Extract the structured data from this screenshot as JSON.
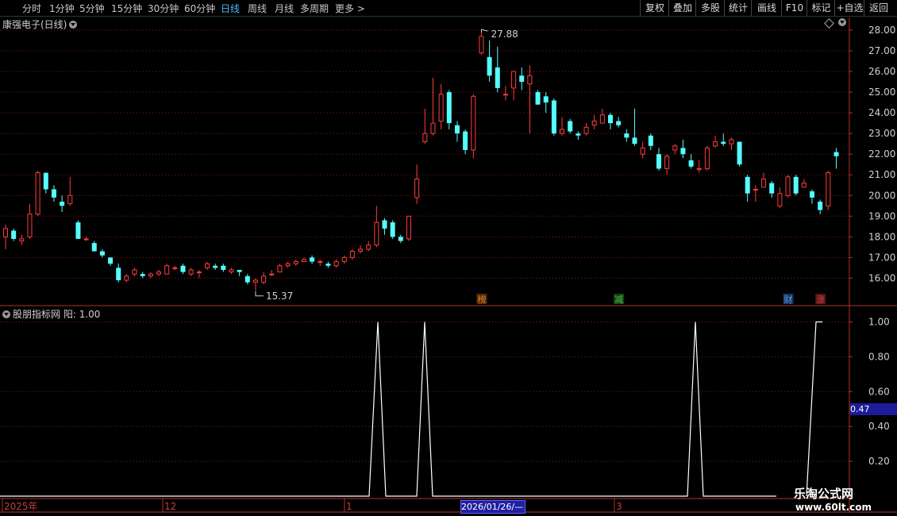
{
  "toolbar": {
    "periods": [
      "分时",
      "1分钟",
      "5分钟",
      "15分钟",
      "30分钟",
      "60分钟",
      "日线",
      "周线",
      "月线",
      "多周期",
      "更多 >"
    ],
    "active_period": "日线",
    "buttons": [
      "复权",
      "叠加",
      "多股",
      "统计",
      "画线",
      "F10",
      "标记",
      "+自选",
      "返回"
    ]
  },
  "price_panel": {
    "title": "康强电子(日线)",
    "y_ticks": [
      "28.00",
      "27.00",
      "26.00",
      "25.00",
      "24.00",
      "23.00",
      "22.00",
      "21.00",
      "20.00",
      "19.00",
      "18.00",
      "17.00",
      "16.00"
    ],
    "high_annotation": "27.88",
    "low_annotation": "15.37",
    "badges": [
      {
        "text": "榜",
        "color": "#e08020"
      },
      {
        "text": "减",
        "color": "#40c040"
      },
      {
        "text": "财",
        "color": "#4a9aff"
      },
      {
        "text": "涨",
        "color": "#e04040"
      }
    ]
  },
  "indicator_panel": {
    "title": "股朋指标网",
    "value_label": "阳: 1.00",
    "y_ticks": [
      "1.00",
      "0.80",
      "0.60",
      "0.40",
      "0.20"
    ],
    "current_value": "0.47"
  },
  "x_axis": {
    "labels": [
      "2025年",
      "12",
      "1",
      "3"
    ],
    "selected_date": "2026/01/26/—"
  },
  "watermark": {
    "line1": "乐淘公式网",
    "line2": "www.60lt.com"
  },
  "colors": {
    "up": "#ff3c3c",
    "down": "#54ffff",
    "grid": "#8b1a1a",
    "axis": "#b03030",
    "line": "#ffffff"
  },
  "chart_data": [
    {
      "type": "candlestick",
      "title": "康强电子(日线)",
      "ylim": [
        15.2,
        28.4
      ],
      "candles": [
        [
          18.0,
          18.4,
          18.6,
          17.4
        ],
        [
          18.3,
          17.9,
          18.4,
          17.8
        ],
        [
          17.8,
          17.9,
          18.1,
          17.6
        ],
        [
          18.0,
          19.1,
          19.6,
          17.9
        ],
        [
          19.1,
          21.1,
          21.2,
          19.0
        ],
        [
          21.1,
          20.3,
          21.1,
          20.1
        ],
        [
          20.3,
          19.9,
          20.5,
          19.7
        ],
        [
          19.7,
          19.5,
          20.0,
          19.2
        ],
        [
          19.6,
          20.0,
          20.9,
          19.5
        ],
        [
          18.7,
          17.9,
          18.8,
          17.9
        ],
        [
          17.9,
          17.9,
          18.0,
          17.8
        ],
        [
          17.7,
          17.3,
          17.8,
          17.3
        ],
        [
          17.3,
          17.1,
          17.4,
          17.0
        ],
        [
          17.0,
          16.7,
          17.0,
          16.6
        ],
        [
          16.5,
          15.9,
          16.7,
          15.8
        ],
        [
          15.9,
          16.1,
          16.2,
          15.8
        ],
        [
          16.2,
          16.4,
          16.5,
          16.1
        ],
        [
          16.2,
          16.1,
          16.3,
          16.0
        ],
        [
          16.1,
          16.2,
          16.3,
          16.0
        ],
        [
          16.2,
          16.3,
          16.4,
          16.1
        ],
        [
          16.2,
          16.6,
          16.7,
          16.2
        ],
        [
          16.5,
          16.5,
          16.6,
          16.4
        ],
        [
          16.6,
          16.3,
          16.7,
          16.2
        ],
        [
          16.2,
          16.4,
          16.5,
          16.1
        ],
        [
          16.3,
          16.3,
          16.4,
          16.0
        ],
        [
          16.5,
          16.7,
          16.8,
          16.4
        ],
        [
          16.6,
          16.5,
          16.7,
          16.4
        ],
        [
          16.6,
          16.4,
          16.7,
          16.3
        ],
        [
          16.3,
          16.4,
          16.5,
          16.2
        ],
        [
          16.4,
          16.3,
          16.4,
          16.1
        ],
        [
          16.1,
          15.8,
          16.2,
          15.7
        ],
        [
          15.8,
          15.9,
          16.0,
          15.4
        ],
        [
          15.8,
          16.1,
          16.3,
          15.7
        ],
        [
          16.2,
          16.2,
          16.4,
          16.1
        ],
        [
          16.3,
          16.6,
          16.7,
          16.3
        ],
        [
          16.6,
          16.7,
          16.8,
          16.5
        ],
        [
          16.7,
          16.8,
          16.9,
          16.6
        ],
        [
          16.8,
          16.9,
          17.0,
          16.8
        ],
        [
          17.0,
          16.8,
          17.1,
          16.7
        ],
        [
          16.8,
          16.8,
          16.9,
          16.6
        ],
        [
          16.7,
          16.6,
          16.8,
          16.5
        ],
        [
          16.6,
          16.8,
          16.9,
          16.5
        ],
        [
          16.8,
          17.0,
          17.1,
          16.7
        ],
        [
          17.0,
          17.3,
          17.4,
          16.9
        ],
        [
          17.3,
          17.4,
          17.6,
          17.2
        ],
        [
          17.4,
          17.6,
          17.8,
          17.3
        ],
        [
          17.6,
          18.7,
          19.5,
          17.5
        ],
        [
          18.8,
          18.4,
          18.9,
          18.1
        ],
        [
          18.7,
          18.0,
          18.8,
          17.9
        ],
        [
          18.0,
          17.8,
          18.1,
          17.7
        ],
        [
          17.9,
          19.0,
          19.0,
          17.8
        ],
        [
          19.9,
          20.8,
          21.5,
          19.6
        ],
        [
          22.6,
          23.0,
          24.2,
          22.5
        ],
        [
          23.0,
          23.5,
          25.7,
          22.9
        ],
        [
          23.6,
          24.9,
          25.4,
          23.2
        ],
        [
          25.0,
          23.5,
          25.1,
          23.2
        ],
        [
          23.4,
          23.0,
          23.6,
          22.6
        ],
        [
          23.1,
          22.2,
          23.2,
          22.0
        ],
        [
          22.2,
          24.8,
          24.9,
          21.8
        ],
        [
          26.9,
          27.7,
          27.9,
          26.8
        ],
        [
          26.7,
          25.8,
          27.5,
          25.5
        ],
        [
          26.2,
          25.2,
          27.2,
          25.0
        ],
        [
          24.9,
          24.9,
          25.3,
          24.6
        ],
        [
          25.2,
          26.0,
          26.0,
          24.6
        ],
        [
          25.8,
          25.5,
          26.2,
          25.1
        ],
        [
          25.4,
          25.8,
          26.3,
          23.0
        ],
        [
          25.0,
          24.4,
          25.1,
          24.4
        ],
        [
          24.8,
          24.5,
          25.0,
          24.0
        ],
        [
          24.6,
          23.0,
          24.7,
          22.9
        ],
        [
          23.0,
          23.2,
          23.8,
          22.9
        ],
        [
          23.6,
          23.1,
          23.7,
          23.0
        ],
        [
          23.0,
          22.9,
          23.1,
          22.7
        ],
        [
          23.0,
          23.3,
          23.5,
          22.9
        ],
        [
          23.4,
          23.6,
          23.9,
          23.2
        ],
        [
          23.5,
          23.9,
          24.2,
          23.5
        ],
        [
          23.9,
          23.5,
          24.0,
          23.2
        ],
        [
          23.6,
          23.4,
          23.8,
          23.3
        ],
        [
          23.0,
          22.8,
          23.2,
          22.6
        ],
        [
          22.8,
          22.5,
          24.2,
          22.4
        ],
        [
          22.0,
          22.3,
          22.6,
          21.8
        ],
        [
          22.9,
          22.4,
          23.0,
          22.2
        ],
        [
          22.0,
          21.3,
          22.3,
          21.2
        ],
        [
          21.3,
          21.9,
          22.0,
          21.0
        ],
        [
          22.2,
          22.4,
          22.5,
          22.0
        ],
        [
          22.3,
          22.0,
          22.7,
          21.8
        ],
        [
          21.7,
          21.4,
          22.0,
          21.3
        ],
        [
          21.3,
          21.3,
          21.7,
          21.1
        ],
        [
          21.3,
          22.3,
          22.4,
          21.2
        ],
        [
          22.4,
          22.6,
          22.9,
          22.3
        ],
        [
          22.6,
          22.5,
          23.0,
          22.4
        ],
        [
          22.5,
          22.7,
          22.8,
          22.2
        ],
        [
          22.6,
          21.5,
          22.6,
          21.4
        ],
        [
          20.9,
          20.1,
          21.0,
          19.7
        ],
        [
          20.3,
          20.3,
          20.5,
          19.7
        ],
        [
          20.4,
          20.8,
          21.1,
          20.4
        ],
        [
          20.6,
          20.1,
          20.7,
          19.9
        ],
        [
          19.5,
          20.1,
          20.4,
          19.4
        ],
        [
          20.0,
          20.9,
          21.0,
          19.9
        ],
        [
          20.9,
          20.1,
          21.0,
          20.0
        ],
        [
          20.4,
          20.6,
          20.8,
          20.4
        ],
        [
          20.2,
          19.9,
          20.3,
          19.6
        ],
        [
          19.7,
          19.3,
          19.8,
          19.1
        ],
        [
          19.5,
          21.1,
          21.2,
          19.3
        ],
        [
          22.1,
          21.9,
          22.3,
          21.3
        ]
      ]
    },
    {
      "type": "line",
      "title": "股朋指标网",
      "series": [
        {
          "name": "阳",
          "x": [
            0,
            1,
            2,
            3,
            4,
            5,
            6,
            7,
            8,
            9
          ],
          "values": [
            0,
            0,
            1,
            0,
            1,
            0,
            0,
            1,
            0,
            1
          ]
        }
      ],
      "ylim": [
        0,
        1
      ]
    }
  ]
}
